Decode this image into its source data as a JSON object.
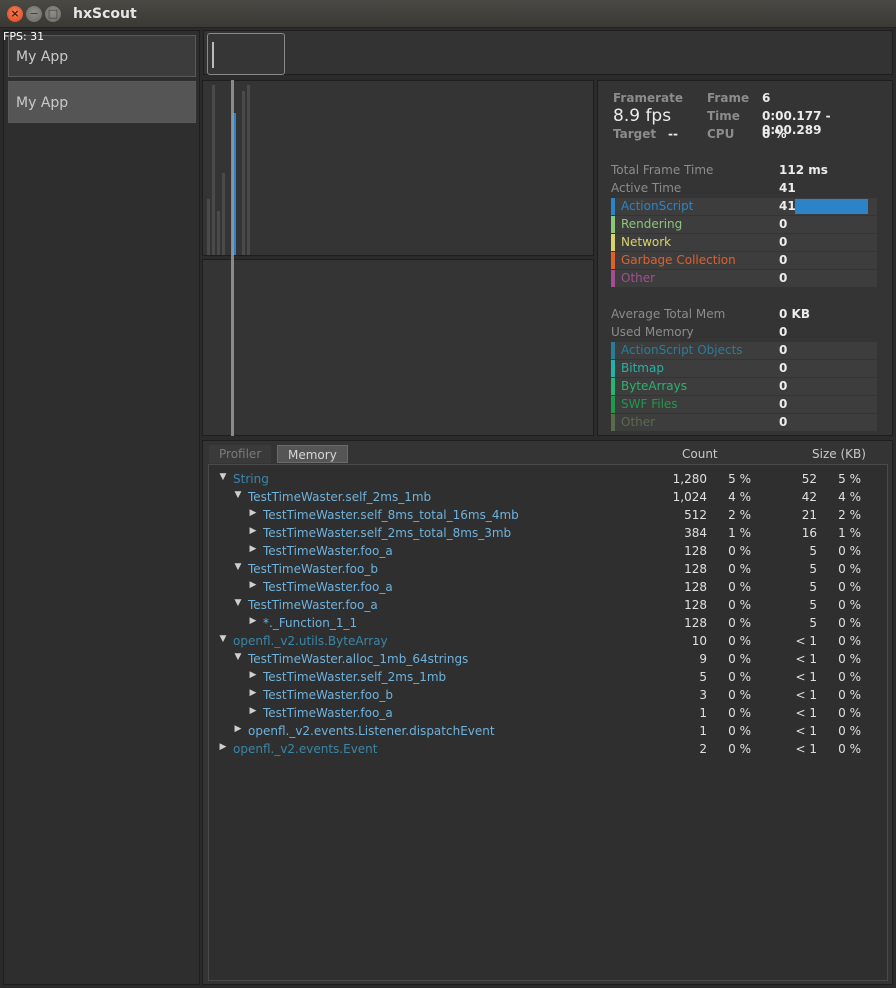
{
  "window": {
    "title": "hxScout",
    "close_icon": "×",
    "minimize_icon": "−",
    "maximize_icon": "□"
  },
  "sidebar": {
    "fps": "FPS: 31",
    "apps": [
      {
        "label": "My App"
      },
      {
        "label": "My App"
      }
    ]
  },
  "stats": {
    "framerate_label": "Framerate",
    "framerate_value": "8.9 fps",
    "target_label": "Target",
    "target_value": "--",
    "frame_label": "Frame",
    "frame_value": "6",
    "time_label": "Time",
    "time_value": "0:00.177 - 0:00.289",
    "cpu_label": "CPU",
    "cpu_value": "0 %",
    "total_frame_time_label": "Total Frame Time",
    "total_frame_time_value": "112 ms",
    "active_time_label": "Active Time",
    "active_time_value": "41",
    "categories": [
      {
        "name": "ActionScript",
        "value": "41",
        "color": "#2d83c7",
        "bar_fraction": 1.0
      },
      {
        "name": "Rendering",
        "value": "0",
        "color": "#8cc67a"
      },
      {
        "name": "Network",
        "value": "0",
        "color": "#d8d46a"
      },
      {
        "name": "Garbage Collection",
        "value": "0",
        "color": "#e0602c"
      },
      {
        "name": "Other",
        "value": "0",
        "color": "#a14f8e"
      }
    ],
    "avg_total_mem_label": "Average Total Mem",
    "avg_total_mem_value": "0 KB",
    "used_memory_label": "Used Memory",
    "used_memory_value": "0",
    "memory_categories": [
      {
        "name": "ActionScript Objects",
        "value": "0",
        "color": "#2b7c9a"
      },
      {
        "name": "Bitmap",
        "value": "0",
        "color": "#27b2a7"
      },
      {
        "name": "ByteArrays",
        "value": "0",
        "color": "#2bb36f"
      },
      {
        "name": "SWF Files",
        "value": "0",
        "color": "#1f9a4a"
      },
      {
        "name": "Other",
        "value": "0",
        "color": "#5b6a4a"
      }
    ]
  },
  "memory_panel": {
    "tabs": [
      "Profiler",
      "Memory"
    ],
    "columns": {
      "count": "Count",
      "size": "Size (KB)"
    },
    "rows": [
      {
        "label": "String",
        "depth": 0,
        "arrow": "▼",
        "count": "1,280",
        "count_pct": "5 %",
        "size": "52",
        "size_pct": "5 %",
        "color": "#3a87a8"
      },
      {
        "label": "TestTimeWaster.self_2ms_1mb",
        "depth": 1,
        "arrow": "▼",
        "count": "1,024",
        "count_pct": "4 %",
        "size": "42",
        "size_pct": "4 %",
        "color": "#6fb2dc"
      },
      {
        "label": "TestTimeWaster.self_8ms_total_16ms_4mb",
        "depth": 2,
        "arrow": "▶",
        "count": "512",
        "count_pct": "2 %",
        "size": "21",
        "size_pct": "2 %",
        "color": "#6fb2dc"
      },
      {
        "label": "TestTimeWaster.self_2ms_total_8ms_3mb",
        "depth": 2,
        "arrow": "▶",
        "count": "384",
        "count_pct": "1 %",
        "size": "16",
        "size_pct": "1 %",
        "color": "#6fb2dc"
      },
      {
        "label": "TestTimeWaster.foo_a",
        "depth": 2,
        "arrow": "▶",
        "count": "128",
        "count_pct": "0 %",
        "size": "5",
        "size_pct": "0 %",
        "color": "#6fb2dc"
      },
      {
        "label": "TestTimeWaster.foo_b",
        "depth": 1,
        "arrow": "▼",
        "count": "128",
        "count_pct": "0 %",
        "size": "5",
        "size_pct": "0 %",
        "color": "#6fb2dc"
      },
      {
        "label": "TestTimeWaster.foo_a",
        "depth": 2,
        "arrow": "▶",
        "count": "128",
        "count_pct": "0 %",
        "size": "5",
        "size_pct": "0 %",
        "color": "#6fb2dc"
      },
      {
        "label": "TestTimeWaster.foo_a",
        "depth": 1,
        "arrow": "▼",
        "count": "128",
        "count_pct": "0 %",
        "size": "5",
        "size_pct": "0 %",
        "color": "#6fb2dc"
      },
      {
        "label": "*._Function_1_1",
        "depth": 2,
        "arrow": "▶",
        "count": "128",
        "count_pct": "0 %",
        "size": "5",
        "size_pct": "0 %",
        "color": "#6fb2dc"
      },
      {
        "label": "openfl._v2.utils.ByteArray",
        "depth": 0,
        "arrow": "▼",
        "count": "10",
        "count_pct": "0 %",
        "size": "< 1",
        "size_pct": "0 %",
        "color": "#3a87a8"
      },
      {
        "label": "TestTimeWaster.alloc_1mb_64strings",
        "depth": 1,
        "arrow": "▼",
        "count": "9",
        "count_pct": "0 %",
        "size": "< 1",
        "size_pct": "0 %",
        "color": "#6fb2dc"
      },
      {
        "label": "TestTimeWaster.self_2ms_1mb",
        "depth": 2,
        "arrow": "▶",
        "count": "5",
        "count_pct": "0 %",
        "size": "< 1",
        "size_pct": "0 %",
        "color": "#6fb2dc"
      },
      {
        "label": "TestTimeWaster.foo_b",
        "depth": 2,
        "arrow": "▶",
        "count": "3",
        "count_pct": "0 %",
        "size": "< 1",
        "size_pct": "0 %",
        "color": "#6fb2dc"
      },
      {
        "label": "TestTimeWaster.foo_a",
        "depth": 2,
        "arrow": "▶",
        "count": "1",
        "count_pct": "0 %",
        "size": "< 1",
        "size_pct": "0 %",
        "color": "#6fb2dc"
      },
      {
        "label": "openfl._v2.events.Listener.dispatchEvent",
        "depth": 1,
        "arrow": "▶",
        "count": "1",
        "count_pct": "0 %",
        "size": "< 1",
        "size_pct": "0 %",
        "color": "#6fb2dc"
      },
      {
        "label": "openfl._v2.events.Event",
        "depth": 0,
        "arrow": "▶",
        "count": "2",
        "count_pct": "0 %",
        "size": "< 1",
        "size_pct": "0 %",
        "color": "#3a87a8"
      }
    ]
  }
}
